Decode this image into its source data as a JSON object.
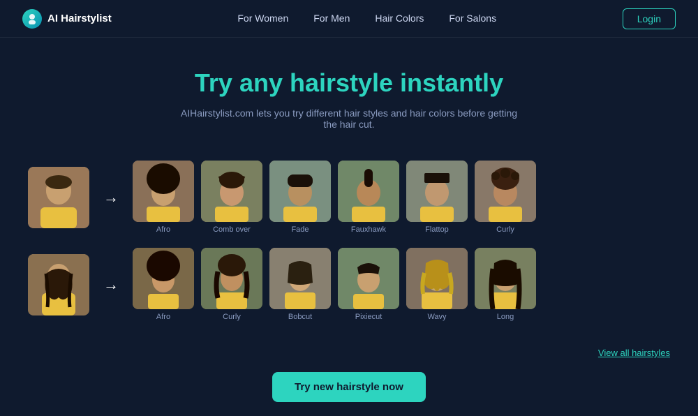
{
  "brand": {
    "name": "AI Hairstylist",
    "logo_alt": "AI Hairstylist logo"
  },
  "nav": {
    "links": [
      {
        "label": "For Women",
        "href": "#"
      },
      {
        "label": "For Men",
        "href": "#"
      },
      {
        "label": "Hair Colors",
        "href": "#"
      },
      {
        "label": "For Salons",
        "href": "#"
      }
    ],
    "login_label": "Login"
  },
  "hero": {
    "headline": "Try any hairstyle instantly",
    "subtext": "AIHairstylist.com lets you try different hair styles and hair colors before getting the hair cut."
  },
  "rows": {
    "men": {
      "styles": [
        {
          "label": "Afro"
        },
        {
          "label": "Comb over"
        },
        {
          "label": "Fade"
        },
        {
          "label": "Fauxhawk"
        },
        {
          "label": "Flattop"
        },
        {
          "label": "Curly"
        }
      ]
    },
    "women": {
      "styles": [
        {
          "label": "Afro"
        },
        {
          "label": "Curly"
        },
        {
          "label": "Bobcut"
        },
        {
          "label": "Pixiecut"
        },
        {
          "label": "Wavy"
        },
        {
          "label": "Long"
        }
      ]
    }
  },
  "view_all": {
    "label": "View all hairstyles"
  },
  "cta": {
    "label": "Try new hairstyle now"
  }
}
